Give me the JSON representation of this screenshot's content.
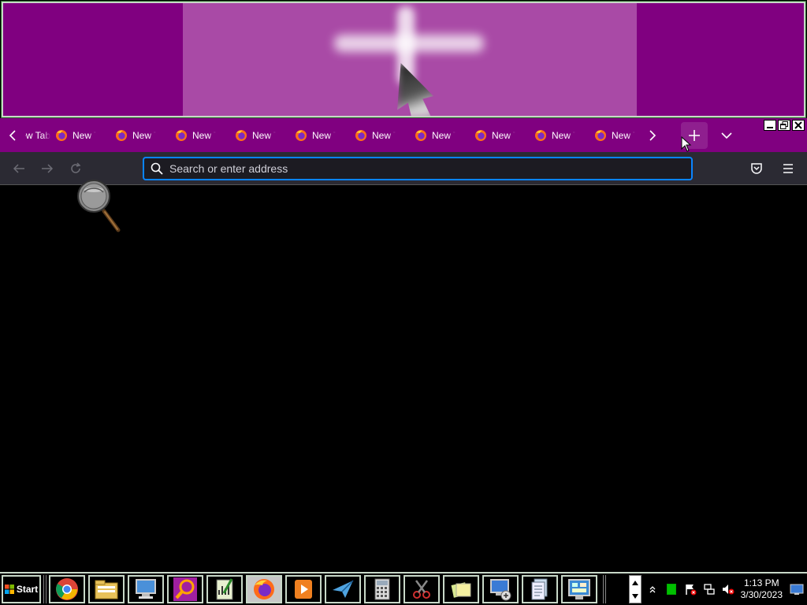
{
  "tabs": {
    "partial_label": "New Tab",
    "items": [
      {
        "label": "New Tab"
      },
      {
        "label": "New Tab"
      },
      {
        "label": "New Tab"
      },
      {
        "label": "New Tab"
      },
      {
        "label": "New Tab"
      },
      {
        "label": "New Tab"
      },
      {
        "label": "New Tab"
      },
      {
        "label": "New Tab"
      },
      {
        "label": "New Tab"
      },
      {
        "label": "New Tab"
      }
    ]
  },
  "urlbar": {
    "placeholder": "Search or enter address",
    "value": ""
  },
  "taskbar": {
    "start_label": "Start",
    "apps": [
      {
        "icon": "chrome-icon"
      },
      {
        "icon": "file-explorer-icon"
      },
      {
        "icon": "computer-icon"
      },
      {
        "icon": "search-magnifier-icon"
      },
      {
        "icon": "notepad-chart-icon"
      },
      {
        "icon": "firefox-icon",
        "active": true
      },
      {
        "icon": "media-player-icon"
      },
      {
        "icon": "paper-plane-icon"
      },
      {
        "icon": "calculator-icon"
      },
      {
        "icon": "snipping-tool-icon"
      },
      {
        "icon": "sticky-notes-icon"
      },
      {
        "icon": "remote-desktop-icon"
      },
      {
        "icon": "document-icon"
      },
      {
        "icon": "control-panel-icon"
      }
    ]
  },
  "clock": {
    "time": "1:13 PM",
    "date": "3/30/2023"
  },
  "colors": {
    "tab_strip": "#800080",
    "urlbar_focus": "#0a84ff",
    "nav_bar": "#2b2a33"
  }
}
